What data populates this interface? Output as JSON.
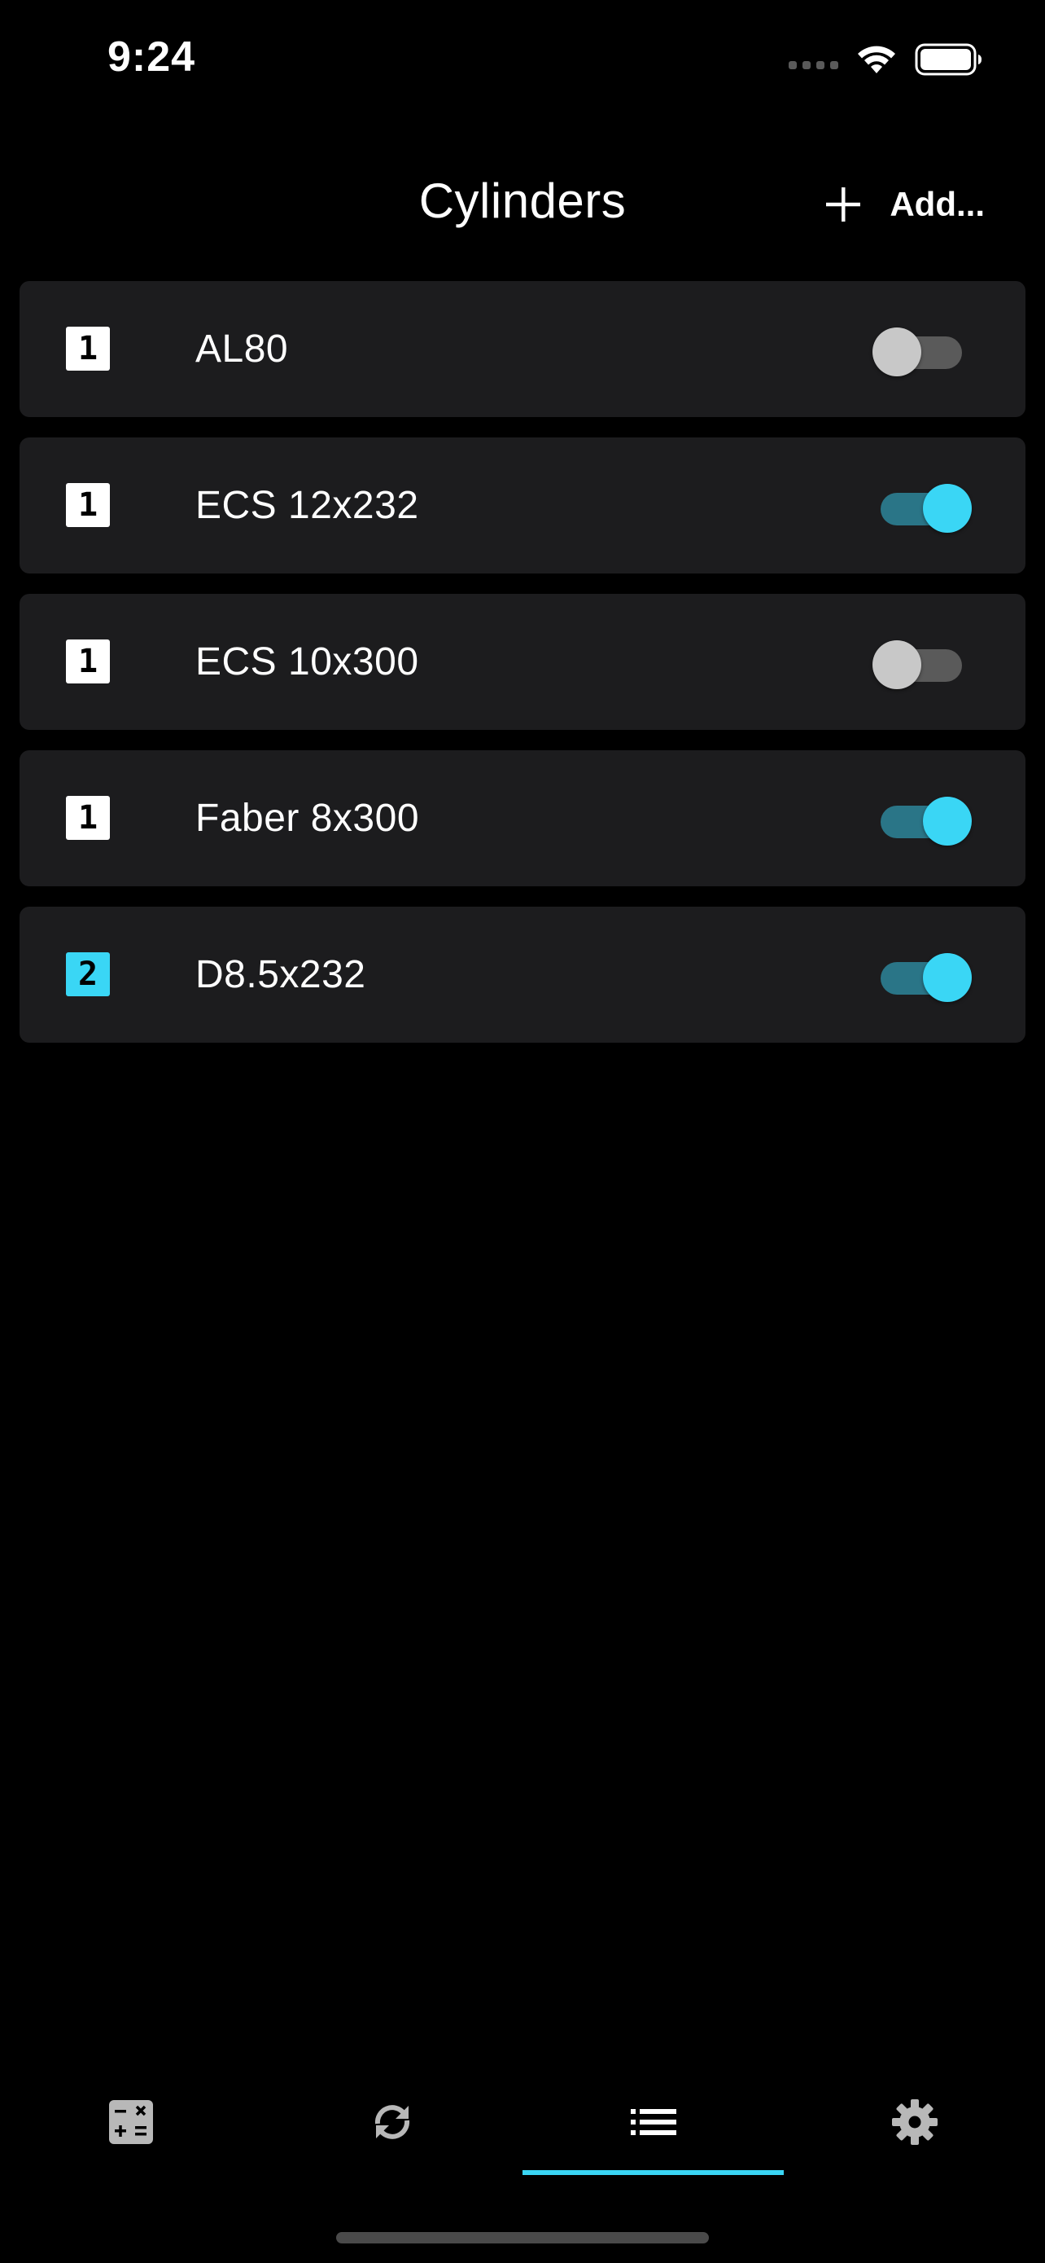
{
  "status_bar": {
    "time": "9:24",
    "icons": [
      "cellular-signal-icon",
      "wifi-icon",
      "battery-icon"
    ]
  },
  "header": {
    "title": "Cylinders",
    "add_label": "Add..."
  },
  "cylinders": [
    {
      "count": "1",
      "name": "AL80",
      "enabled": false
    },
    {
      "count": "1",
      "name": "ECS 12x232",
      "enabled": true
    },
    {
      "count": "1",
      "name": "ECS 10x300",
      "enabled": false
    },
    {
      "count": "1",
      "name": "Faber 8x300",
      "enabled": true
    },
    {
      "count": "2",
      "name": "D8.5x232",
      "enabled": true
    }
  ],
  "tabs": [
    {
      "icon": "calculator-icon",
      "selected": false
    },
    {
      "icon": "refresh-icon",
      "selected": false
    },
    {
      "icon": "list-icon",
      "selected": true
    },
    {
      "icon": "gear-icon",
      "selected": false
    }
  ],
  "colors": {
    "background": "#000000",
    "row_background": "#1c1c1e",
    "accent": "#3ad6f5",
    "toggle_on_track": "#2a7587",
    "toggle_off_track": "#5a5a5a",
    "toggle_off_thumb": "#c8c8c8",
    "icon_gray": "#b8b8b8"
  }
}
